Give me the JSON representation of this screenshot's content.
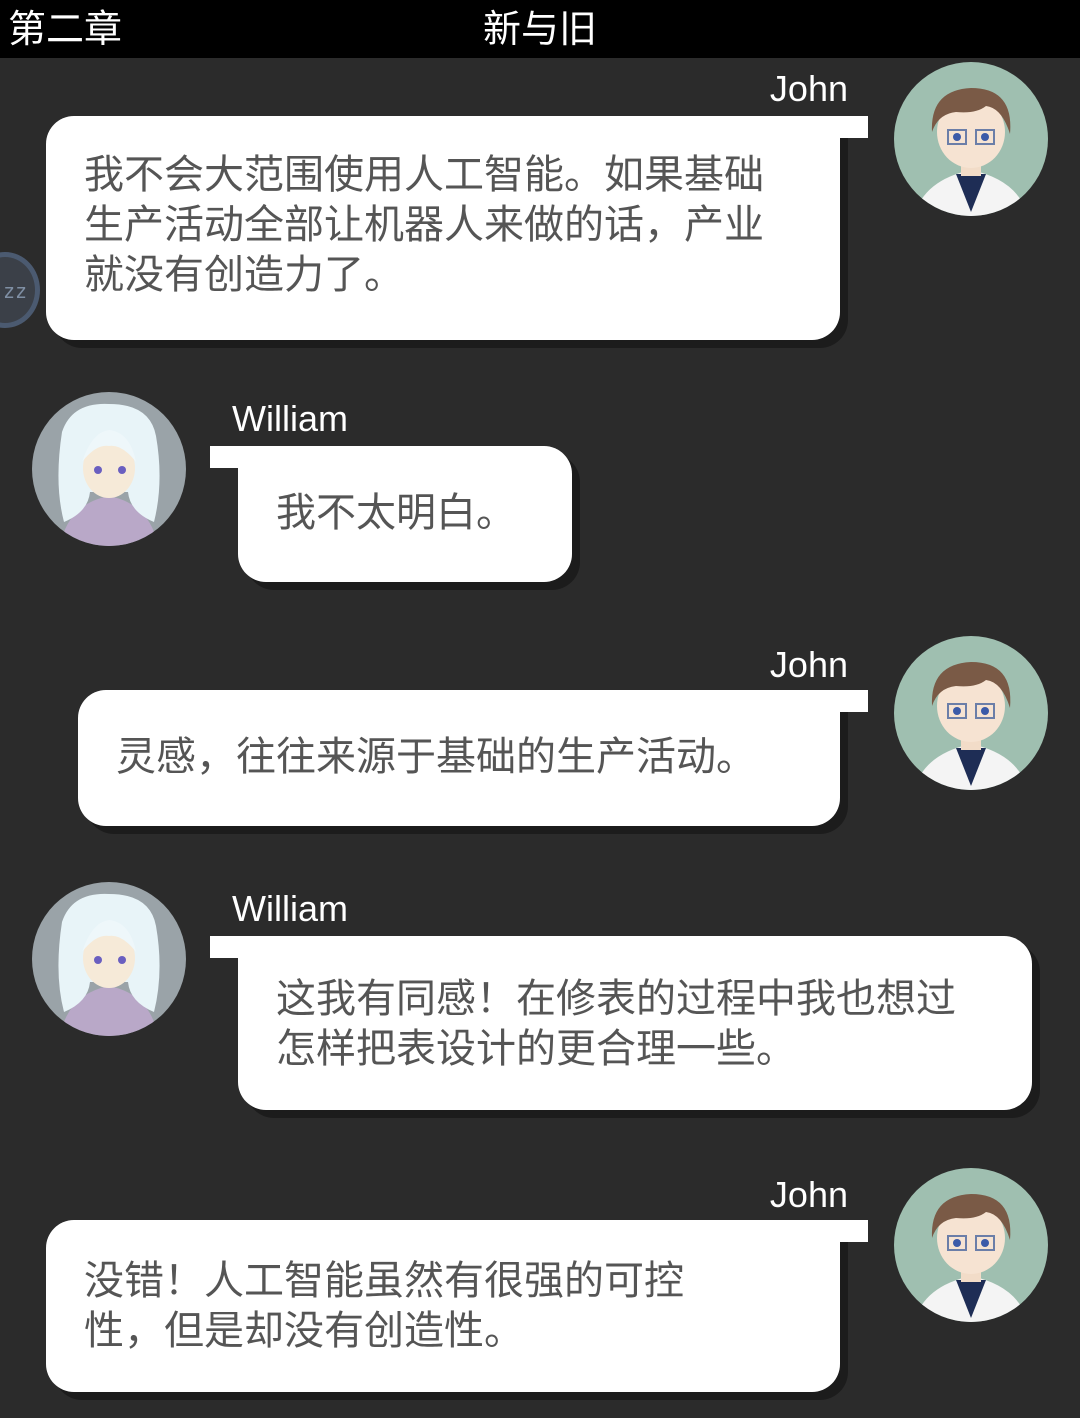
{
  "header": {
    "chapter": "第二章",
    "title": "新与旧"
  },
  "floating_button": {
    "label": "zz"
  },
  "messages": [
    {
      "speaker": "John",
      "text": "我不会大范围使用人工智能。如果基础生产活动全部让机器人来做的话，产业就没有创造力了。"
    },
    {
      "speaker": "William",
      "text": "我不太明白。"
    },
    {
      "speaker": "John",
      "text": "灵感，往往来源于基础的生产活动。"
    },
    {
      "speaker": "William",
      "text": "这我有同感！在修表的过程中我也想过怎样把表设计的更合理一些。"
    },
    {
      "speaker": "John",
      "text": "没错！人工智能虽然有很强的可控性，但是却没有创造性。"
    }
  ],
  "colors": {
    "background": "#2b2b2b",
    "header_bg": "#000000",
    "bubble": "#ffffff",
    "bubble_text": "#555555",
    "john_avatar_bg": "#9fbfb0",
    "william_avatar_bg": "#9aa3a8"
  }
}
